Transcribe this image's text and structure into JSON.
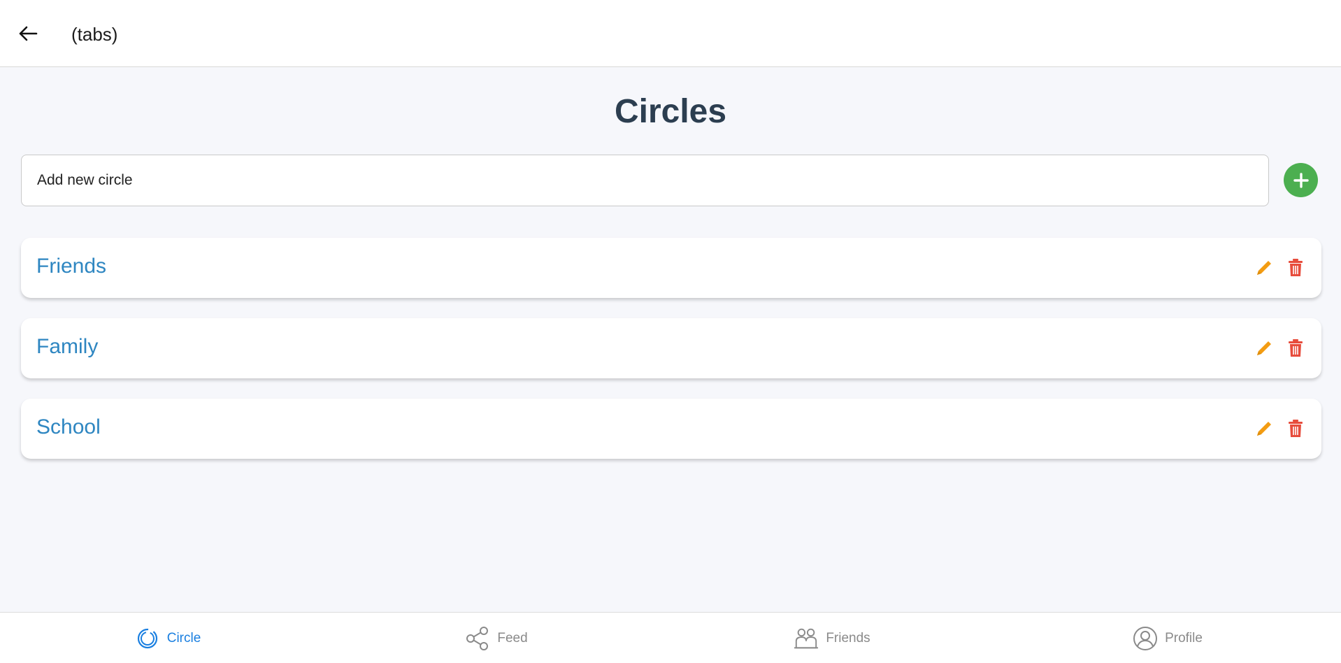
{
  "header": {
    "title": "(tabs)"
  },
  "main": {
    "title": "Circles",
    "new_circle": {
      "value": "Add new circle",
      "placeholder": "Add new circle"
    },
    "circles": [
      {
        "name": "Friends"
      },
      {
        "name": "Family"
      },
      {
        "name": "School"
      }
    ]
  },
  "tabs": [
    {
      "label": "Circle",
      "icon": "circle-icon",
      "active": true
    },
    {
      "label": "Feed",
      "icon": "share-icon",
      "active": false
    },
    {
      "label": "Friends",
      "icon": "people-icon",
      "active": false
    },
    {
      "label": "Profile",
      "icon": "person-icon",
      "active": false
    }
  ],
  "colors": {
    "accent": "#2e86c1",
    "active_tab": "#1a7fe0",
    "add": "#4caf50",
    "edit": "#f39c12",
    "delete": "#e74c3c",
    "title": "#2c3e50"
  }
}
